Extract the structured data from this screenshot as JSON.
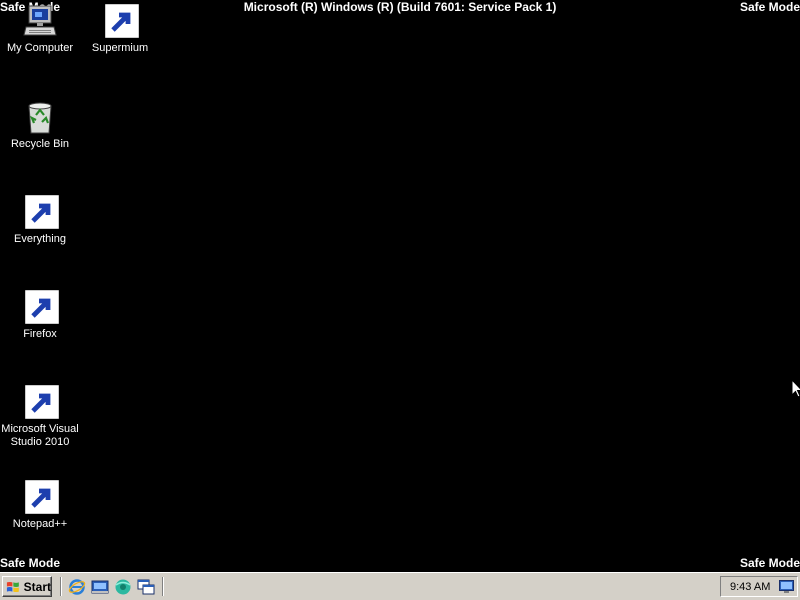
{
  "desktop": {
    "mode_label": "Safe Mode",
    "title": "Microsoft (R) Windows (R) (Build 7601: Service Pack 1)",
    "icons": [
      {
        "label": "My Computer",
        "icon": "computer-icon"
      },
      {
        "label": "Supermium",
        "icon": "supermium-icon"
      },
      {
        "label": "Recycle Bin",
        "icon": "recycle-bin-icon"
      },
      {
        "label": "Everything",
        "icon": "everything-icon"
      },
      {
        "label": "Firefox",
        "icon": "firefox-icon"
      },
      {
        "label": "Microsoft Visual Studio 2010",
        "icon": "visual-studio-icon"
      },
      {
        "label": "Notepad++",
        "icon": "notepadpp-icon"
      }
    ]
  },
  "taskbar": {
    "start_label": "Start",
    "quick_launch": [
      "internet-explorer-icon",
      "show-desktop-icon",
      "supermium-icon",
      "window-switch-icon"
    ],
    "clock": "9:43 AM"
  },
  "colors": {
    "desktop_bg": "#000000",
    "taskbar_bg": "#d4d0c8",
    "text": "#ffffff"
  }
}
